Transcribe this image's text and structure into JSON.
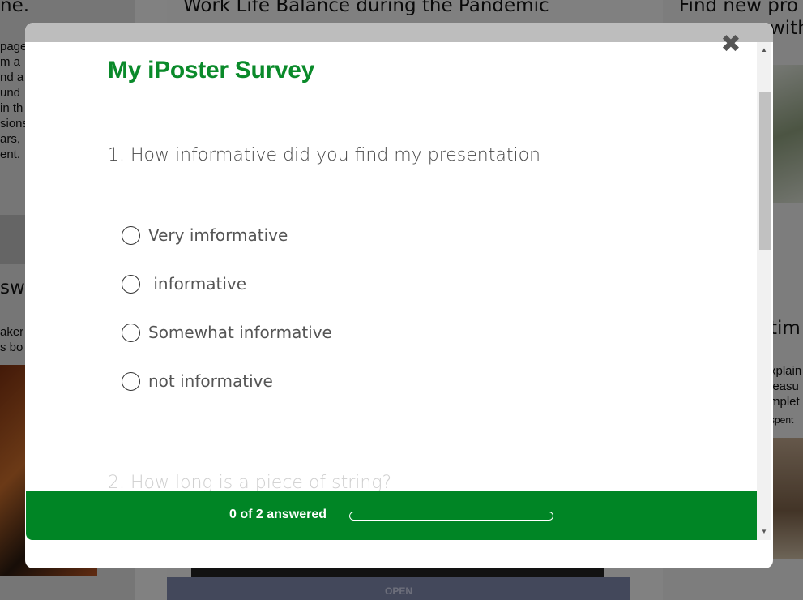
{
  "background": {
    "left_title": "ne.",
    "mid_title": "Work Life Balance during the Pandemic",
    "right_title_1": "Find new pro",
    "right_title_2": "with",
    "left_text_lines": [
      "page",
      "m a",
      "nd a",
      "und",
      "in th",
      "sions",
      "ars,",
      "ent."
    ],
    "left_title_2": "sw",
    "left_text_lines_2": [
      "aker",
      "s bo"
    ],
    "right_title_3": "tim",
    "right_text_lines": [
      "xplain",
      "leasu",
      "mplet",
      "spent"
    ],
    "open_label": "OPEN"
  },
  "modal": {
    "close_icon": "close-icon",
    "title": "My iPoster Survey",
    "questions": [
      {
        "label": "1. How informative did you find my presentation",
        "options": [
          "Very imformative",
          " informative",
          "Somewhat informative",
          "not informative"
        ]
      },
      {
        "label": "2. How long is a piece of string?"
      }
    ],
    "progress": {
      "text": "0 of 2 answered",
      "answered": 0,
      "total": 2
    },
    "colors": {
      "title": "#0a8a2a",
      "footer": "#008525"
    }
  }
}
